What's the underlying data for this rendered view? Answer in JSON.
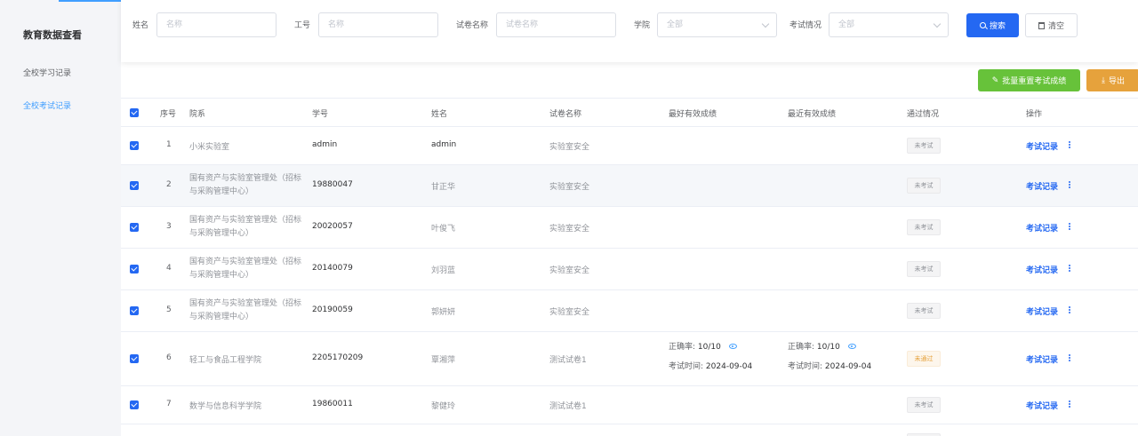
{
  "sidebar": {
    "title": "教育数据查看",
    "items": [
      {
        "label": "全校学习记录",
        "active": false
      },
      {
        "label": "全校考试记录",
        "active": true
      }
    ]
  },
  "filters": {
    "name": {
      "label": "姓名",
      "placeholder": "名称"
    },
    "emp_id": {
      "label": "工号",
      "placeholder": "名称"
    },
    "paper": {
      "label": "试卷名称",
      "placeholder": "试卷名称"
    },
    "college": {
      "label": "学院",
      "value": "全部"
    },
    "exam_status": {
      "label": "考试情况",
      "value": "全部"
    },
    "search_label": "搜索",
    "clear_label": "清空"
  },
  "actions": {
    "batch_reset_label": "批量重置考试成绩",
    "export_label": "导出"
  },
  "table": {
    "headers": {
      "index": "序号",
      "dept": "院系",
      "student_id": "学号",
      "name": "姓名",
      "paper": "试卷名称",
      "best": "最好有效成绩",
      "recent": "最近有效成绩",
      "status": "通过情况",
      "ops": "操作"
    },
    "op_label": "考试记录",
    "accuracy_label": "正确率:",
    "exam_time_label": "考试时间:",
    "rows": [
      {
        "index": "1",
        "dept": "小米实验室",
        "student_id": "admin",
        "name": "admin",
        "paper": "实验室安全",
        "status": "未考试"
      },
      {
        "index": "2",
        "dept": "国有资产与实验室管理处（招标与采购管理中心）",
        "student_id": "19880047",
        "name": "甘正华",
        "paper": "实验室安全",
        "status": "未考试"
      },
      {
        "index": "3",
        "dept": "国有资产与实验室管理处（招标与采购管理中心）",
        "student_id": "20020057",
        "name": "叶俊飞",
        "paper": "实验室安全",
        "status": "未考试"
      },
      {
        "index": "4",
        "dept": "国有资产与实验室管理处（招标与采购管理中心）",
        "student_id": "20140079",
        "name": "刘羽蓝",
        "paper": "实验室安全",
        "status": "未考试"
      },
      {
        "index": "5",
        "dept": "国有资产与实验室管理处（招标与采购管理中心）",
        "student_id": "20190059",
        "name": "郭妍妍",
        "paper": "实验室安全",
        "status": "未考试"
      },
      {
        "index": "6",
        "dept": "轻工与食品工程学院",
        "student_id": "2205170209",
        "name": "覃湘萍",
        "paper": "测试试卷1",
        "status": "未通过",
        "best": {
          "accuracy": "10/10",
          "time": "2024-09-04"
        },
        "recent": {
          "accuracy": "10/10",
          "time": "2024-09-04"
        }
      },
      {
        "index": "7",
        "dept": "数学与信息科学学院",
        "student_id": "19860011",
        "name": "黎健玲",
        "paper": "测试试卷1",
        "status": "未考试"
      }
    ]
  }
}
